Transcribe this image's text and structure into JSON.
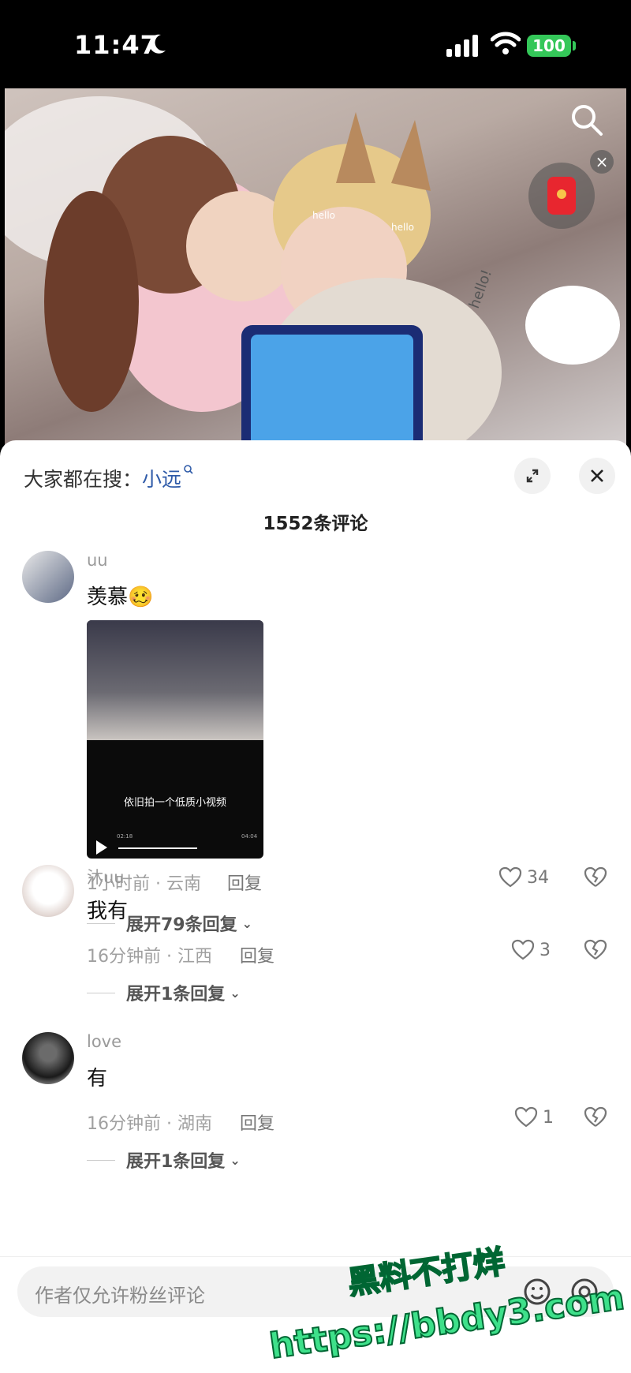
{
  "status_bar": {
    "time": "11:47",
    "battery": "100"
  },
  "video": {
    "overlay_texts": [
      "hello",
      "hello",
      "hello!"
    ]
  },
  "sheet": {
    "trend_prefix": "大家都在搜：",
    "trend_keyword": "小远",
    "comment_count": "1552条评论"
  },
  "comments": [
    {
      "user": "uu",
      "text": "羡慕🥴",
      "time_location": "1小时前 · 云南",
      "reply": "回复",
      "likes": "34",
      "expand": "展开79条回复",
      "video_caption": "依旧拍一个低质小视频",
      "video_time_start": "02:18",
      "video_time_end": "04:04"
    },
    {
      "user": "沐uu",
      "text": "我有",
      "time_location": "16分钟前 · 江西",
      "reply": "回复",
      "likes": "3",
      "expand": "展开1条回复"
    },
    {
      "user": "love",
      "text": "有",
      "time_location": "16分钟前 · 湖南",
      "reply": "回复",
      "likes": "1",
      "expand": "展开1条回复"
    }
  ],
  "input": {
    "placeholder": "作者仅允许粉丝评论"
  },
  "watermark": {
    "line1": "黑料不打烊",
    "line2": "https://bbdy3.com"
  },
  "colors": {
    "accent": "#2e5aa8",
    "battery": "#34c759",
    "redpacket": "#e8262f"
  }
}
